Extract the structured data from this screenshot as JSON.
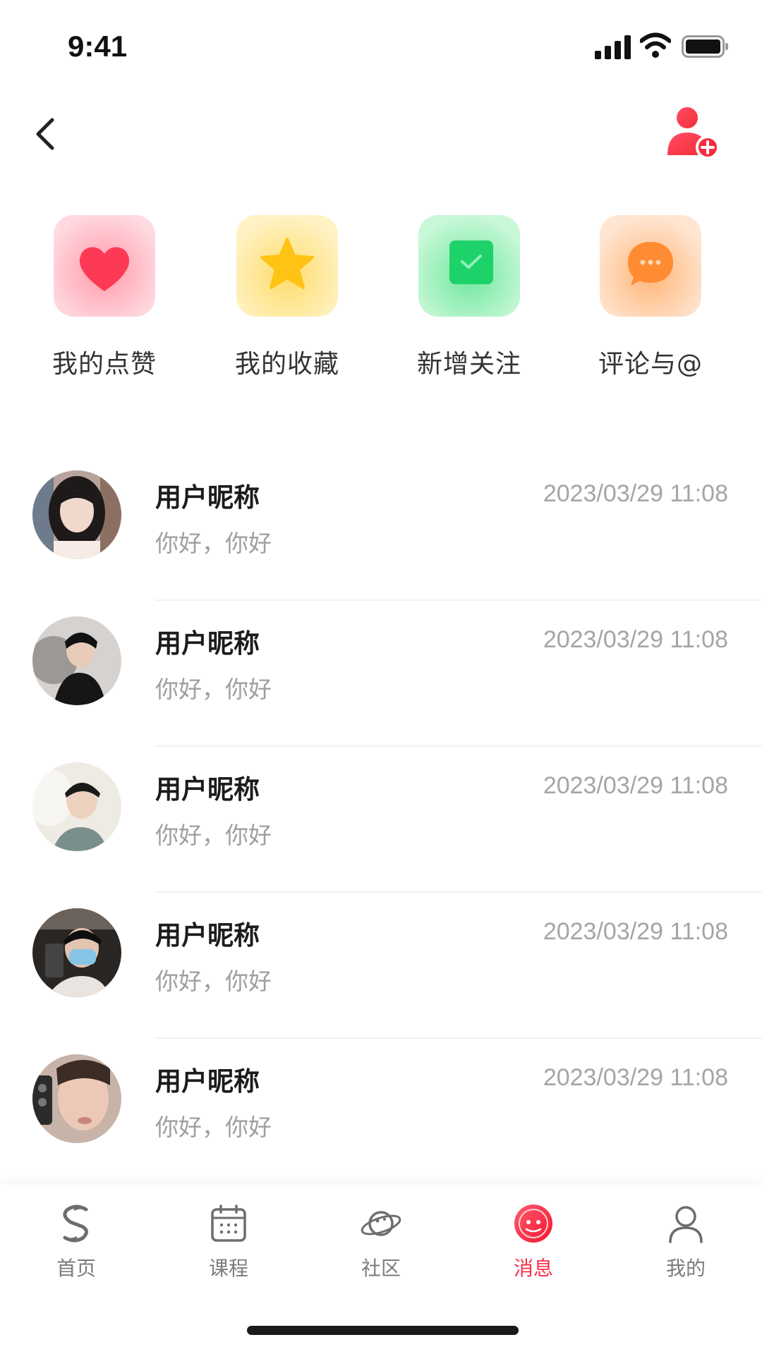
{
  "status_bar": {
    "time": "9:41",
    "icons": [
      "signal-icon",
      "wifi-icon",
      "battery-icon"
    ]
  },
  "nav": {
    "back_icon": "chevron-left-icon",
    "action_icon": "add-user-icon",
    "accent_color": "#fa2c47"
  },
  "quick_actions": [
    {
      "label": "我的点赞",
      "icon": "heart-icon",
      "tile_color": "#ffdbe1",
      "icon_color": "#fd3a56"
    },
    {
      "label": "我的收藏",
      "icon": "star-icon",
      "tile_color": "#fff2c4",
      "icon_color": "#ffc315"
    },
    {
      "label": "新增关注",
      "icon": "check-icon",
      "tile_color": "#c9f8d8",
      "icon_color": "#1ed26a"
    },
    {
      "label": "评论与@",
      "icon": "comment-icon",
      "tile_color": "#ffe6d3",
      "icon_color": "#ff8b33"
    }
  ],
  "messages": [
    {
      "name": "用户昵称",
      "time": "2023/03/29 11:08",
      "preview": "你好，你好"
    },
    {
      "name": "用户昵称",
      "time": "2023/03/29 11:08",
      "preview": "你好，你好"
    },
    {
      "name": "用户昵称",
      "time": "2023/03/29 11:08",
      "preview": "你好，你好"
    },
    {
      "name": "用户昵称",
      "time": "2023/03/29 11:08",
      "preview": "你好，你好"
    },
    {
      "name": "用户昵称",
      "time": "2023/03/29 11:08",
      "preview": "你好，你好"
    }
  ],
  "tab_bar": {
    "active_index": 3,
    "active_color": "#fa2c47",
    "tabs": [
      {
        "label": "首页",
        "icon": "home-icon"
      },
      {
        "label": "课程",
        "icon": "calendar-icon"
      },
      {
        "label": "社区",
        "icon": "planet-icon"
      },
      {
        "label": "消息",
        "icon": "message-icon"
      },
      {
        "label": "我的",
        "icon": "user-icon"
      }
    ]
  }
}
